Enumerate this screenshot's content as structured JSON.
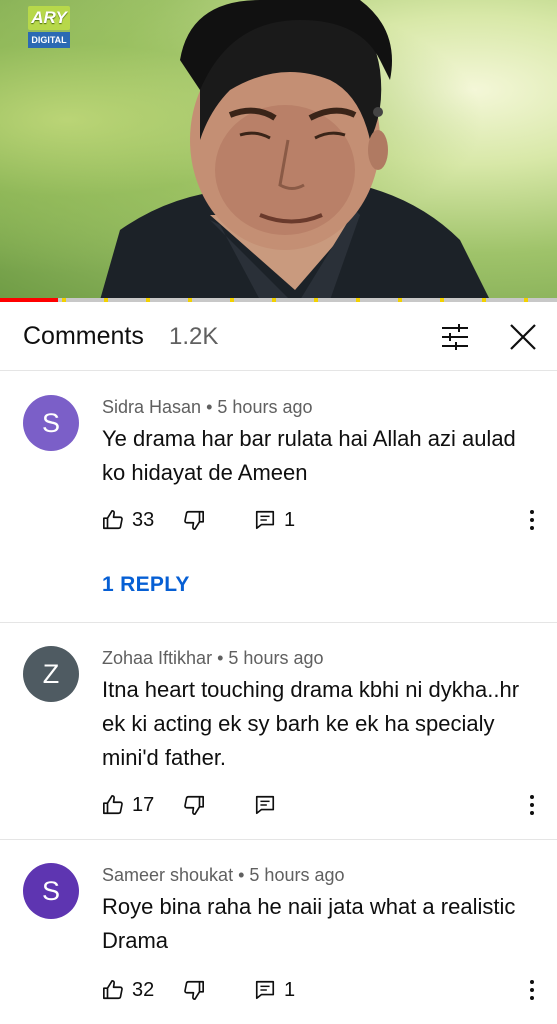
{
  "video": {
    "logo_top": "ARY",
    "logo_bottom": "DIGITAL",
    "played_fraction": 0.104
  },
  "header": {
    "title": "Comments",
    "count": "1.2K",
    "filter_icon": "sort-filter-icon",
    "close_icon": "close-icon"
  },
  "comments": [
    {
      "initial": "S",
      "avatar_color": "#7b5fc8",
      "author": "Sidra Hasan",
      "separator": "•",
      "time": "5 hours ago",
      "text": "Ye drama har bar rulata hai Allah azi aulad ko hidayat de Ameen",
      "likes": "33",
      "replies_count": "1",
      "reply_label": "1 REPLY"
    },
    {
      "initial": "Z",
      "avatar_color": "#4f5b62",
      "author": "Zohaa Iftikhar",
      "separator": "•",
      "time": "5 hours ago",
      "text": "Itna heart touching drama kbhi ni dykha..hr ek ki acting ek sy barh ke ek ha specialy mini'd father.",
      "likes": "17",
      "replies_count": ""
    },
    {
      "initial": "S",
      "avatar_color": "#5e35b1",
      "author": "Sameer shoukat",
      "separator": "•",
      "time": "5 hours ago",
      "text": "Roye bina raha he naii jata what a realistic Drama",
      "likes": "32",
      "replies_count": "1"
    }
  ]
}
